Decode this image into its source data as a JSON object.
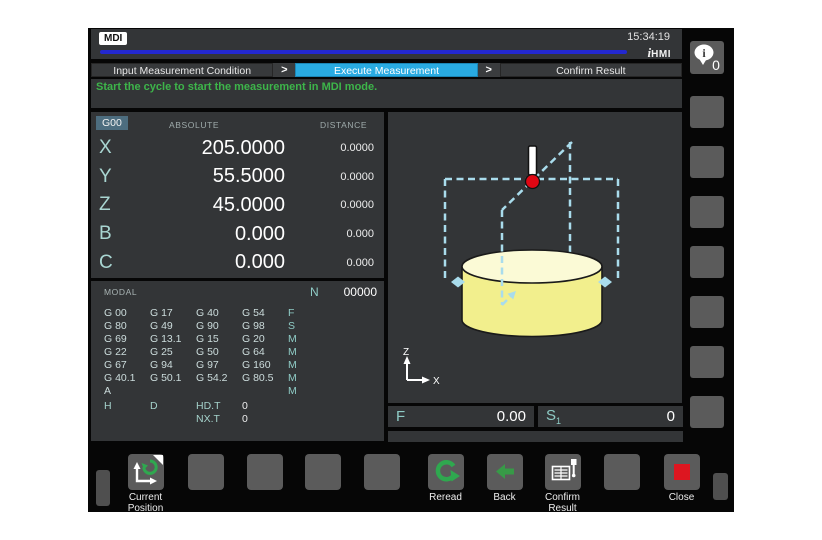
{
  "colors": {
    "active_step_blue": "#29abe2",
    "progress_blue": "#2328cf",
    "message_green": "#3db54a",
    "icon_green": "#2fa84f",
    "close_red": "#dd1620",
    "probe_red": "#e00613",
    "workpiece_yellow": "#f2ef8d",
    "path_dash_cyan": "#a9dcec",
    "axis_teal": "#a9d6d2"
  },
  "topbar": {
    "mode": "MDI",
    "time": "15:34:19",
    "logo_i": "i",
    "logo_hmi": "HMI"
  },
  "breadcrumb": {
    "chevron": ">",
    "steps": [
      "Input Measurement Condition",
      "Execute Measurement",
      "Confirm Result"
    ],
    "active": "Execute Measurement"
  },
  "message": "Start the cycle to start the measurement in MDI mode.",
  "position": {
    "gcode_badge": "G00",
    "col_absolute": "ABSOLUTE",
    "col_distance": "DISTANCE",
    "axes": [
      {
        "name": "X",
        "absolute": "205.0000",
        "distance": "0.0000"
      },
      {
        "name": "Y",
        "absolute": "55.5000",
        "distance": "0.0000"
      },
      {
        "name": "Z",
        "absolute": "45.0000",
        "distance": "0.0000"
      },
      {
        "name": "B",
        "absolute": "0.000",
        "distance": "0.000"
      },
      {
        "name": "C",
        "absolute": "0.000",
        "distance": "0.000"
      }
    ]
  },
  "modal": {
    "title": "MODAL",
    "n_label": "N",
    "n_value": "00000",
    "gcode_rows": [
      [
        "G 00",
        "G 17",
        "G 40",
        "G 54",
        "F"
      ],
      [
        "G 80",
        "G 49",
        "G 90",
        "G 98",
        "S"
      ],
      [
        "G 69",
        "G 13.1",
        "G 15",
        "G 20",
        "M"
      ],
      [
        "G 22",
        "G 25",
        "G 50",
        "G 64",
        "M"
      ],
      [
        "G 67",
        "G 94",
        "G 97",
        "G 160",
        "M"
      ],
      [
        "G 40.1",
        "G 50.1",
        "G 54.2",
        "G 80.5",
        "M"
      ],
      [
        "A",
        "",
        "",
        "",
        "M"
      ]
    ],
    "tool_rows": [
      [
        "H",
        "D",
        "HD.T",
        "0"
      ],
      [
        "",
        "",
        "NX.T",
        "0"
      ]
    ]
  },
  "graphic": {
    "axis_z": "Z",
    "axis_x": "X"
  },
  "feed": {
    "label": "F",
    "value": "0.00"
  },
  "spindle": {
    "label": "S",
    "sub": "1",
    "value": "0"
  },
  "softkeys": [
    {
      "label": "Current\nPosition",
      "icon": "current-position-icon"
    },
    {
      "label": "",
      "icon": ""
    },
    {
      "label": "",
      "icon": ""
    },
    {
      "label": "",
      "icon": ""
    },
    {
      "label": "",
      "icon": ""
    },
    {
      "label": "Reread",
      "icon": "reread-icon"
    },
    {
      "label": "Back",
      "icon": "back-icon"
    },
    {
      "label": "Confirm\nResult",
      "icon": "confirm-result-icon"
    },
    {
      "label": "",
      "icon": ""
    },
    {
      "label": "Close",
      "icon": "close-icon"
    }
  ],
  "right_column": {
    "info_badge": "0"
  }
}
